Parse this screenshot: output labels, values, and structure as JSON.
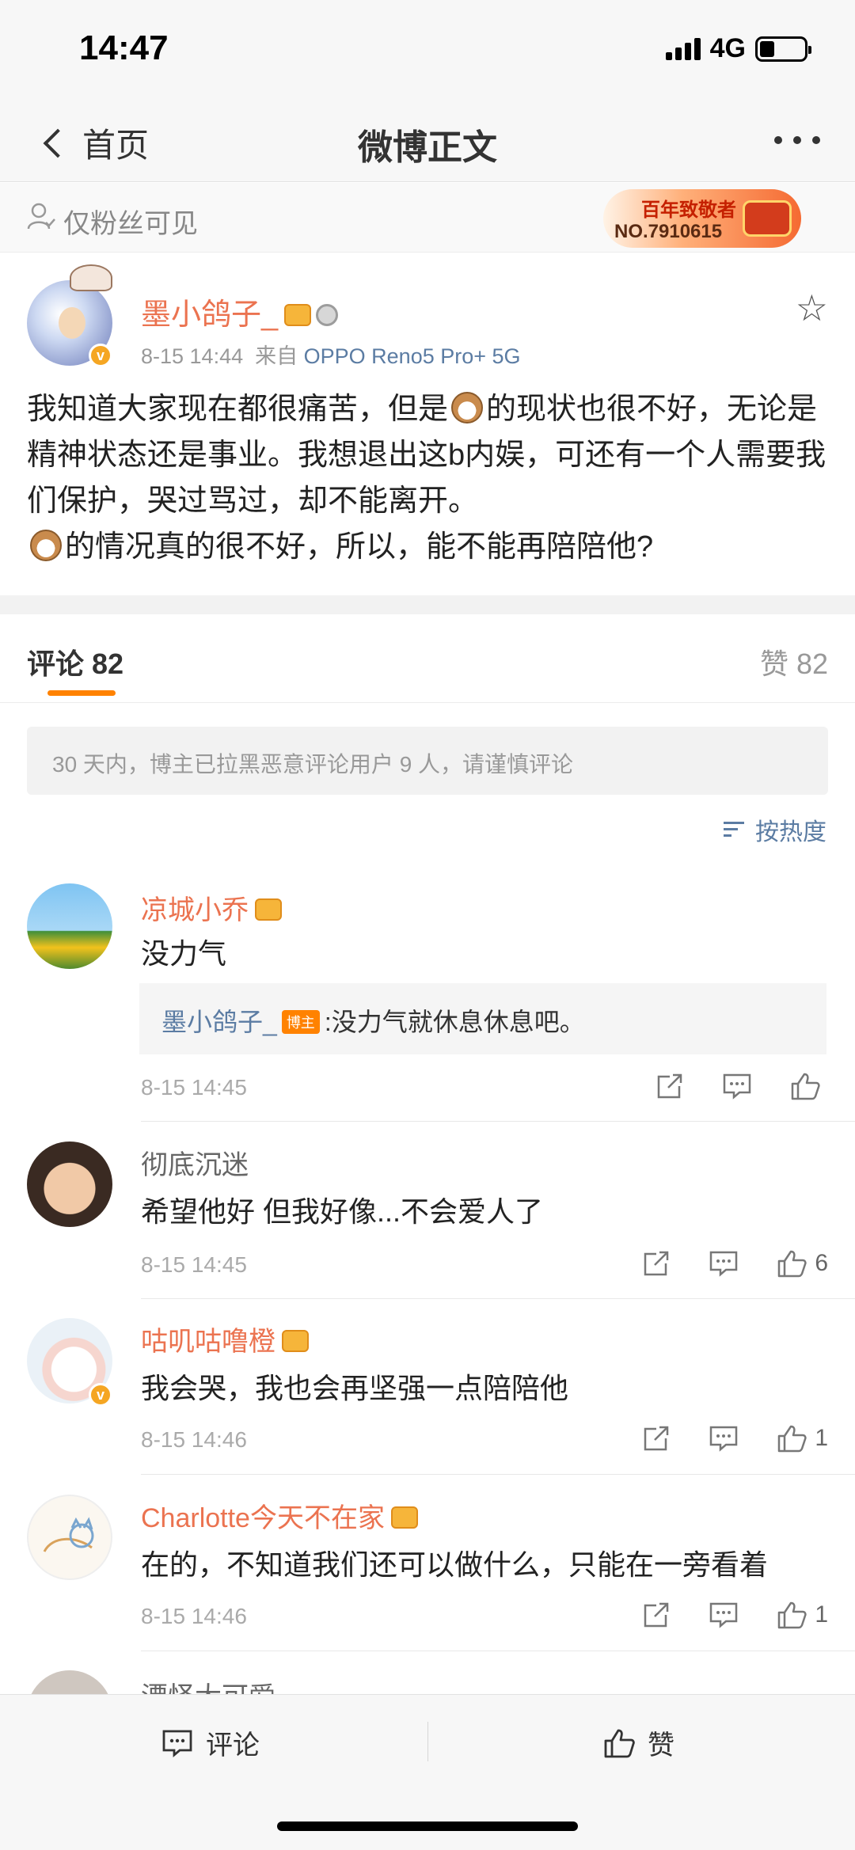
{
  "status": {
    "time": "14:47",
    "network": "4G"
  },
  "nav": {
    "back_label": "首页",
    "title": "微博正文"
  },
  "privacy": {
    "text": "仅粉丝可见",
    "badge_title": "百年致敬者",
    "badge_number": "NO.7910615"
  },
  "post": {
    "author": "墨小鸽子_",
    "time": "8-15 14:44",
    "source_prefix": "来自",
    "source": "OPPO Reno5 Pro+ 5G",
    "body_1": "我知道大家现在都很痛苦，但是",
    "body_2": "的现状也很不好，无论是精神状态还是事业。我想退出这b内娱，可还有一个人需要我们保护，哭过骂过，却不能离开。",
    "body_3": "的情况真的很不好，所以，能不能再陪陪他?"
  },
  "tabs": {
    "comments": "评论 82",
    "likes": "赞 82"
  },
  "notice": "30 天内，博主已拉黑恶意评论用户 9 人，请谨慎评论",
  "sort_label": "按热度",
  "comments": [
    {
      "name": "凉城小乔",
      "text": "没力气",
      "reply_name": "墨小鸽子_",
      "reply_tag": "博主",
      "reply_text": ":没力气就休息休息吧。",
      "time": "8-15 14:45",
      "likes": ""
    },
    {
      "name": "彻底沉迷",
      "text": "希望他好 但我好像...不会爱人了",
      "time": "8-15 14:45",
      "likes": "6"
    },
    {
      "name": "咕叽咕噜橙",
      "text": "我会哭，我也会再坚强一点陪陪他",
      "time": "8-15 14:46",
      "likes": "1"
    },
    {
      "name": "Charlotte今天不在家",
      "text": "在的，不知道我们还可以做什么，只能在一旁看着",
      "time": "8-15 14:46",
      "likes": "1"
    },
    {
      "name": "漂怪大可爱"
    }
  ],
  "bottom": {
    "comment_label": "评论",
    "like_label": "赞"
  },
  "colors": {
    "accent": "#ff8200",
    "name": "#eb7350",
    "link": "#5b7ca3"
  }
}
